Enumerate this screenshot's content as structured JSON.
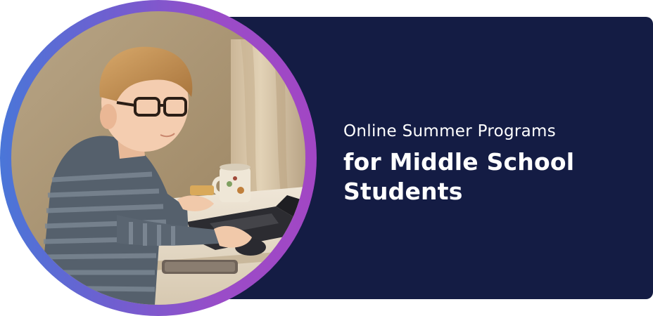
{
  "banner": {
    "line1": "Online Summer Programs",
    "line2": "for Middle School Students"
  },
  "photo": {
    "subject": "boy with glasses using a laptop"
  },
  "colors": {
    "panel": "#141c44",
    "ring_start": "#4a76d8",
    "ring_end": "#a246c4",
    "text": "#ffffff"
  }
}
